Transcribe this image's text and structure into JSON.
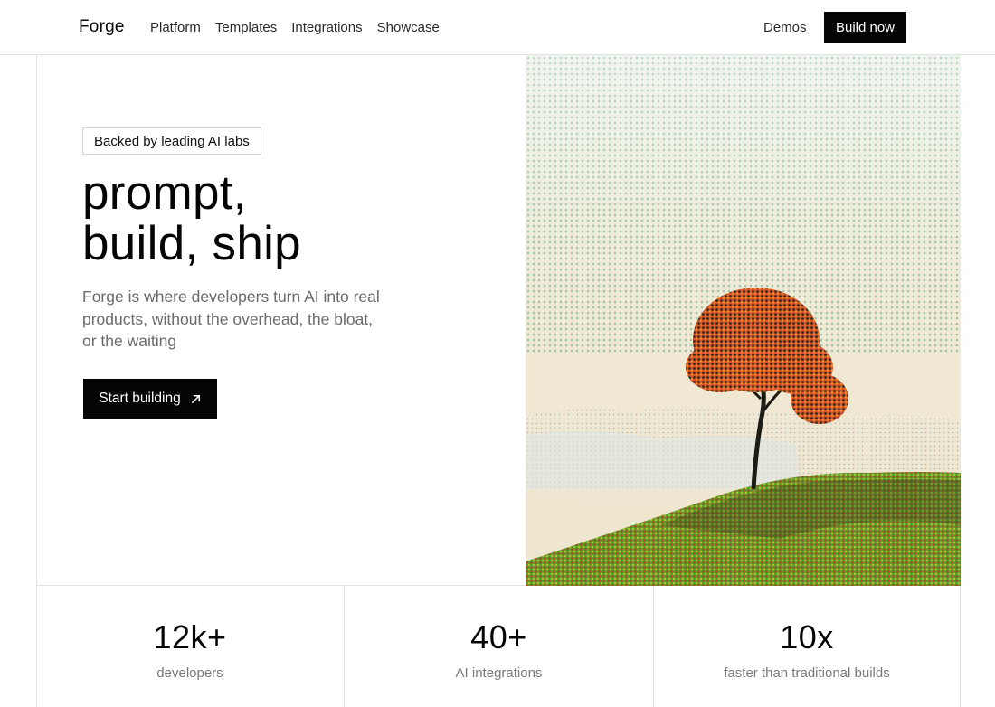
{
  "nav": {
    "brand": "Forge",
    "links": [
      "Platform",
      "Templates",
      "Integrations",
      "Showcase"
    ],
    "demos": "Demos",
    "build_now": "Build now"
  },
  "hero": {
    "badge": "Backed by leading AI labs",
    "headline_line1": "prompt,",
    "headline_line2": "build, ship",
    "subtext": "Forge is where developers turn AI into real products, without the overhead, the bloat, or the waiting",
    "cta_label": "Start building",
    "cta_icon": "arrow-up-right-icon",
    "image_subject": "halftone-tree-on-hill"
  },
  "stats": [
    {
      "value": "12k+",
      "label": "developers"
    },
    {
      "value": "40+",
      "label": "AI integrations"
    },
    {
      "value": "10x",
      "label": "faster than traditional builds"
    }
  ],
  "colors": {
    "button_bg": "#050505",
    "border": "#e3e3e3",
    "muted_text": "#6b6b6b",
    "sky": "#efe8d6",
    "foliage": "#d9542a",
    "grass": "#4f9a2a"
  }
}
